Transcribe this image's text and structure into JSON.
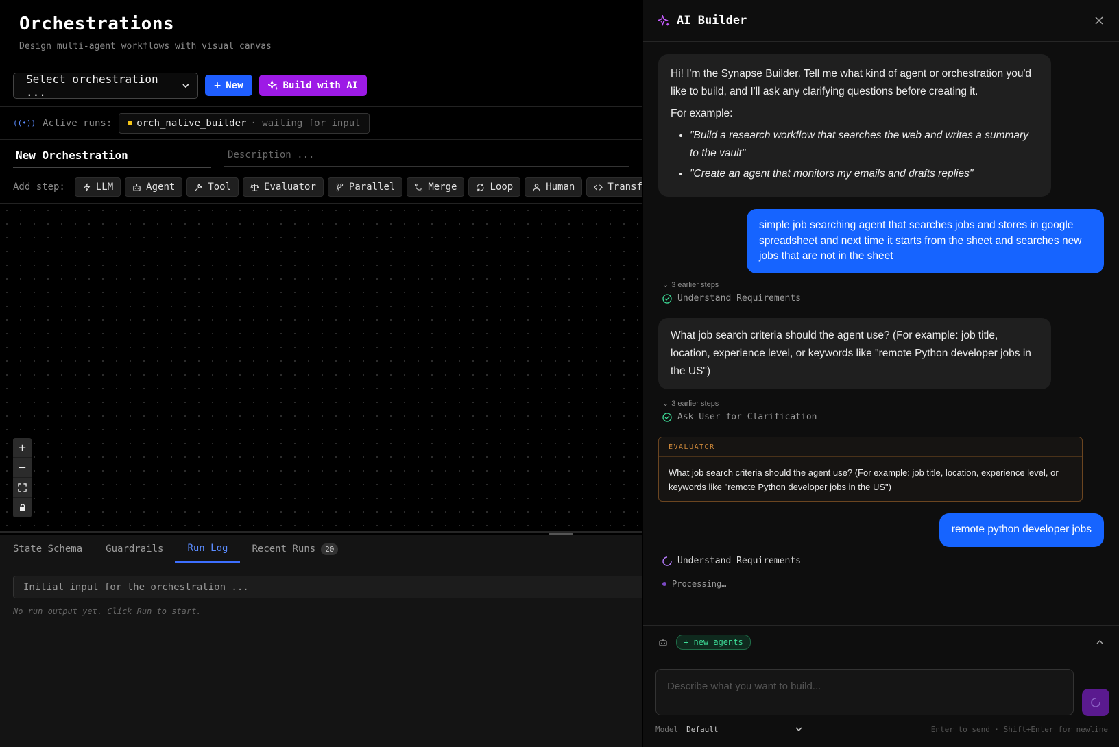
{
  "header": {
    "title": "Orchestrations",
    "subtitle": "Design multi-agent workflows with visual canvas"
  },
  "toolbar": {
    "select_value": "Select orchestration ...",
    "new_label": "New",
    "build_label": "Build with AI"
  },
  "runs": {
    "label": "Active runs:",
    "run_name": "orch_native_builder",
    "run_status": "· waiting for input"
  },
  "orchestration": {
    "name": "New Orchestration",
    "description_placeholder": "Description ..."
  },
  "steps": {
    "label": "Add step:",
    "items": [
      {
        "label": "LLM",
        "icon": "bolt-icon"
      },
      {
        "label": "Agent",
        "icon": "robot-icon"
      },
      {
        "label": "Tool",
        "icon": "wrench-icon"
      },
      {
        "label": "Evaluator",
        "icon": "scale-icon"
      },
      {
        "label": "Parallel",
        "icon": "branch-icon"
      },
      {
        "label": "Merge",
        "icon": "merge-icon"
      },
      {
        "label": "Loop",
        "icon": "loop-icon"
      },
      {
        "label": "Human",
        "icon": "user-icon"
      },
      {
        "label": "Transform",
        "icon": "code-icon"
      }
    ]
  },
  "bottom": {
    "tabs": [
      {
        "label": "State Schema"
      },
      {
        "label": "Guardrails"
      },
      {
        "label": "Run Log"
      },
      {
        "label": "Recent Runs",
        "count": "20"
      }
    ],
    "active_tab": "Run Log",
    "input_placeholder": "Initial input for the orchestration ...",
    "empty_text": "No run output yet. Click Run to start."
  },
  "builder": {
    "title": "AI Builder",
    "messages": {
      "intro": "Hi! I'm the Synapse Builder. Tell me what kind of agent or orchestration you'd like to build, and I'll ask any clarifying questions before creating it.",
      "for_example": "For example:",
      "example_1": "\"Build a research workflow that searches the web and writes a summary to the vault\"",
      "example_2": "\"Create an agent that monitors my emails and drafts replies\"",
      "user_1": "simple job searching agent that searches jobs and stores in google spreadsheet and next time it starts from the sheet and searches new jobs that are not in the sheet",
      "earlier_1": "3 earlier steps",
      "step_1": "Understand Requirements",
      "ai_question": "What job search criteria should the agent use? (For example: job title, location, experience level, or keywords like \"remote Python developer jobs in the US\")",
      "earlier_2": "3 earlier steps",
      "step_2": "Ask User for Clarification",
      "eval_label": "EVALUATOR",
      "eval_text": "What job search criteria should the agent use? (For example: job title, location, experience level, or keywords like \"remote Python developer jobs in the US\")",
      "user_2": "remote python developer jobs",
      "step_3": "Understand Requirements",
      "processing": "Processing…"
    },
    "agents_pill": "+ new agents",
    "composer_placeholder": "Describe what you want to build...",
    "model_label": "Model",
    "model_value": "Default",
    "hint": "Enter to send · Shift+Enter for newline"
  },
  "colors": {
    "accent_blue": "#1f5eff",
    "accent_purple": "#9d1ae6",
    "success": "#3ddc97",
    "evaluator": "#d08a3b"
  }
}
